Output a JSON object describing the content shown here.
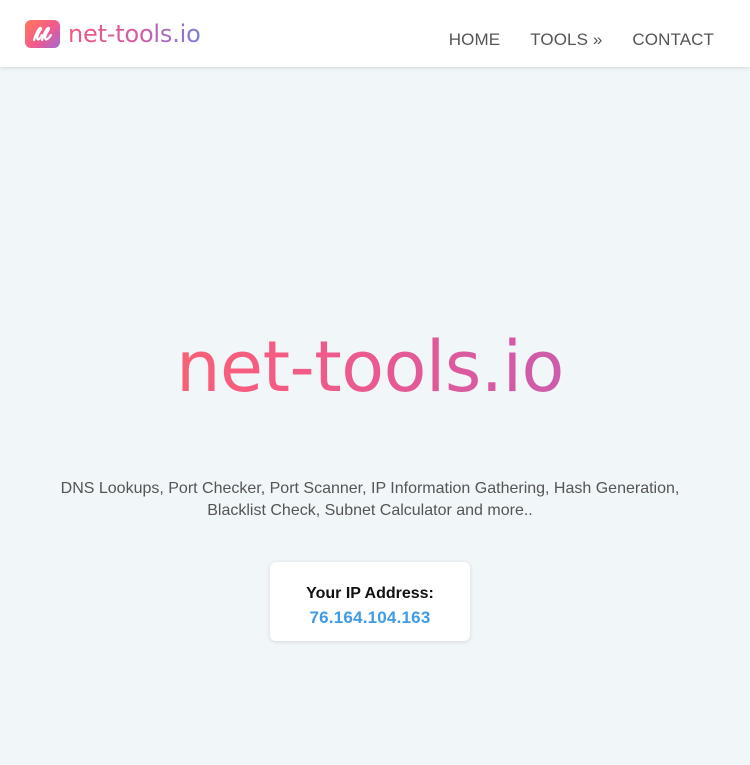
{
  "header": {
    "brand_text": "net-tools.io",
    "logo_icon": "net-tools-logo-icon",
    "nav": [
      {
        "label": "HOME"
      },
      {
        "label": "TOOLS »"
      },
      {
        "label": "CONTACT"
      }
    ]
  },
  "hero": {
    "title": "net-tools.io",
    "subtitle": "DNS Lookups, Port Checker, Port Scanner, IP Information Gathering, Hash Generation, Blacklist Check, Subnet Calculator and more.."
  },
  "ip_card": {
    "label": "Your IP Address:",
    "value": "76.164.104.163"
  },
  "colors": {
    "background": "#f1f6f9",
    "nav_text": "#555555",
    "ip_value": "#3f9be6",
    "gradient_start": "#ff6a5e",
    "gradient_end": "#a86ab8"
  }
}
